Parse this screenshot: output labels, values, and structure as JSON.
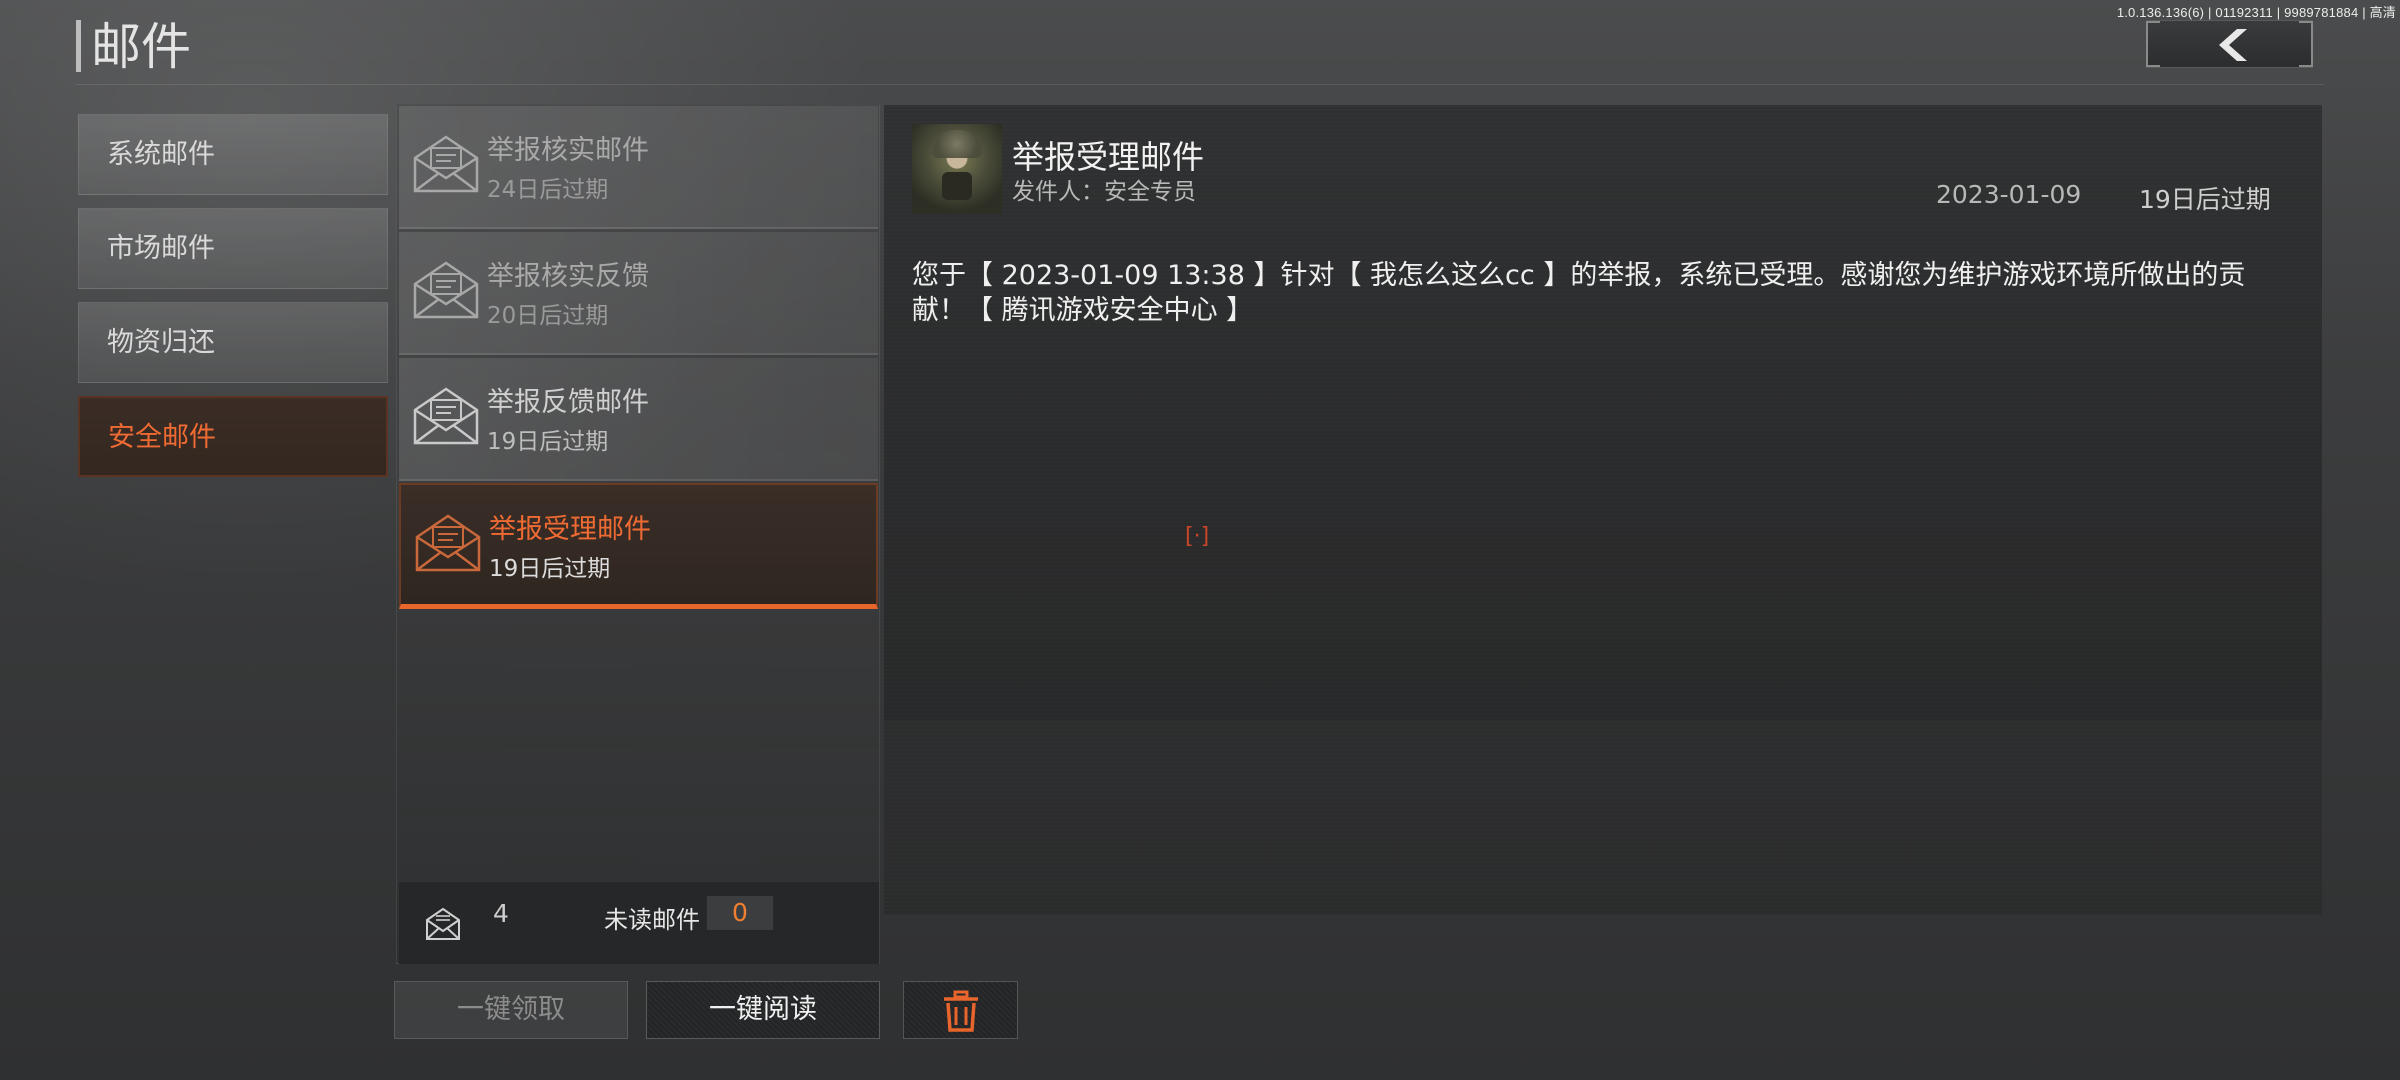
{
  "version": "1.0.136.136(6) | 01192311 | 9989781884 | 高清",
  "page_title": "邮件",
  "categories": [
    {
      "label": "系统邮件",
      "active": false
    },
    {
      "label": "市场邮件",
      "active": false
    },
    {
      "label": "物资归还",
      "active": false
    },
    {
      "label": "安全邮件",
      "active": true
    }
  ],
  "mails": [
    {
      "title": "举报核实邮件",
      "expire": "24日后过期",
      "state": "read"
    },
    {
      "title": "举报核实反馈",
      "expire": "20日后过期",
      "state": "read"
    },
    {
      "title": "举报反馈邮件",
      "expire": "19日后过期",
      "state": "unread"
    },
    {
      "title": "举报受理邮件",
      "expire": "19日后过期",
      "state": "selected"
    }
  ],
  "stats": {
    "total": "4",
    "unread_label": "未读邮件",
    "unread_count": "0"
  },
  "buttons": {
    "claim_all": "一键领取",
    "read_all": "一键阅读"
  },
  "detail": {
    "title": "举报受理邮件",
    "sender": "发件人：安全专员",
    "date": "2023-01-09",
    "expire": "19日后过期",
    "body": "您于【 2023-01-09 13:38 】针对【 我怎么这么cc 】的举报，系统已受理。感谢您为维护游戏环境所做出的贡献！【 腾讯游戏安全中心 】"
  },
  "reticle": "[·]",
  "colors": {
    "accent": "#ef6b33",
    "unread_badge": "#f08030"
  }
}
